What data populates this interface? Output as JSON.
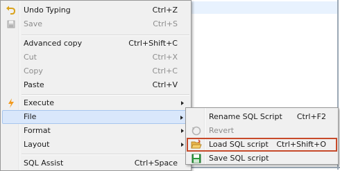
{
  "main_menu": [
    {
      "label": "Undo Typing",
      "shortcut": "Ctrl+Z",
      "icon": "undo-icon"
    },
    {
      "label": "Save",
      "shortcut": "Ctrl+S",
      "icon": "save-icon"
    },
    {
      "label": "Advanced copy",
      "shortcut": "Ctrl+Shift+C"
    },
    {
      "label": "Cut",
      "shortcut": "Ctrl+X"
    },
    {
      "label": "Copy",
      "shortcut": "Ctrl+C"
    },
    {
      "label": "Paste",
      "shortcut": "Ctrl+V"
    },
    {
      "label": "Execute",
      "icon": "lightning-icon"
    },
    {
      "label": "File"
    },
    {
      "label": "Format"
    },
    {
      "label": "Layout"
    },
    {
      "label": "SQL Assist",
      "shortcut": "Ctrl+Space"
    }
  ],
  "file_submenu": [
    {
      "label": "Rename SQL Script",
      "shortcut": "Ctrl+F2"
    },
    {
      "label": "Revert",
      "icon": "revert-icon"
    },
    {
      "label": "Load SQL script",
      "shortcut": "Ctrl+Shift+O",
      "icon": "folder-open-icon"
    },
    {
      "label": "Save SQL script",
      "icon": "save-script-icon"
    }
  ],
  "colors": {
    "highlight_border": "#c74a2a",
    "hover_background": "#d9e7fb",
    "menu_background": "#f0f0f0"
  }
}
